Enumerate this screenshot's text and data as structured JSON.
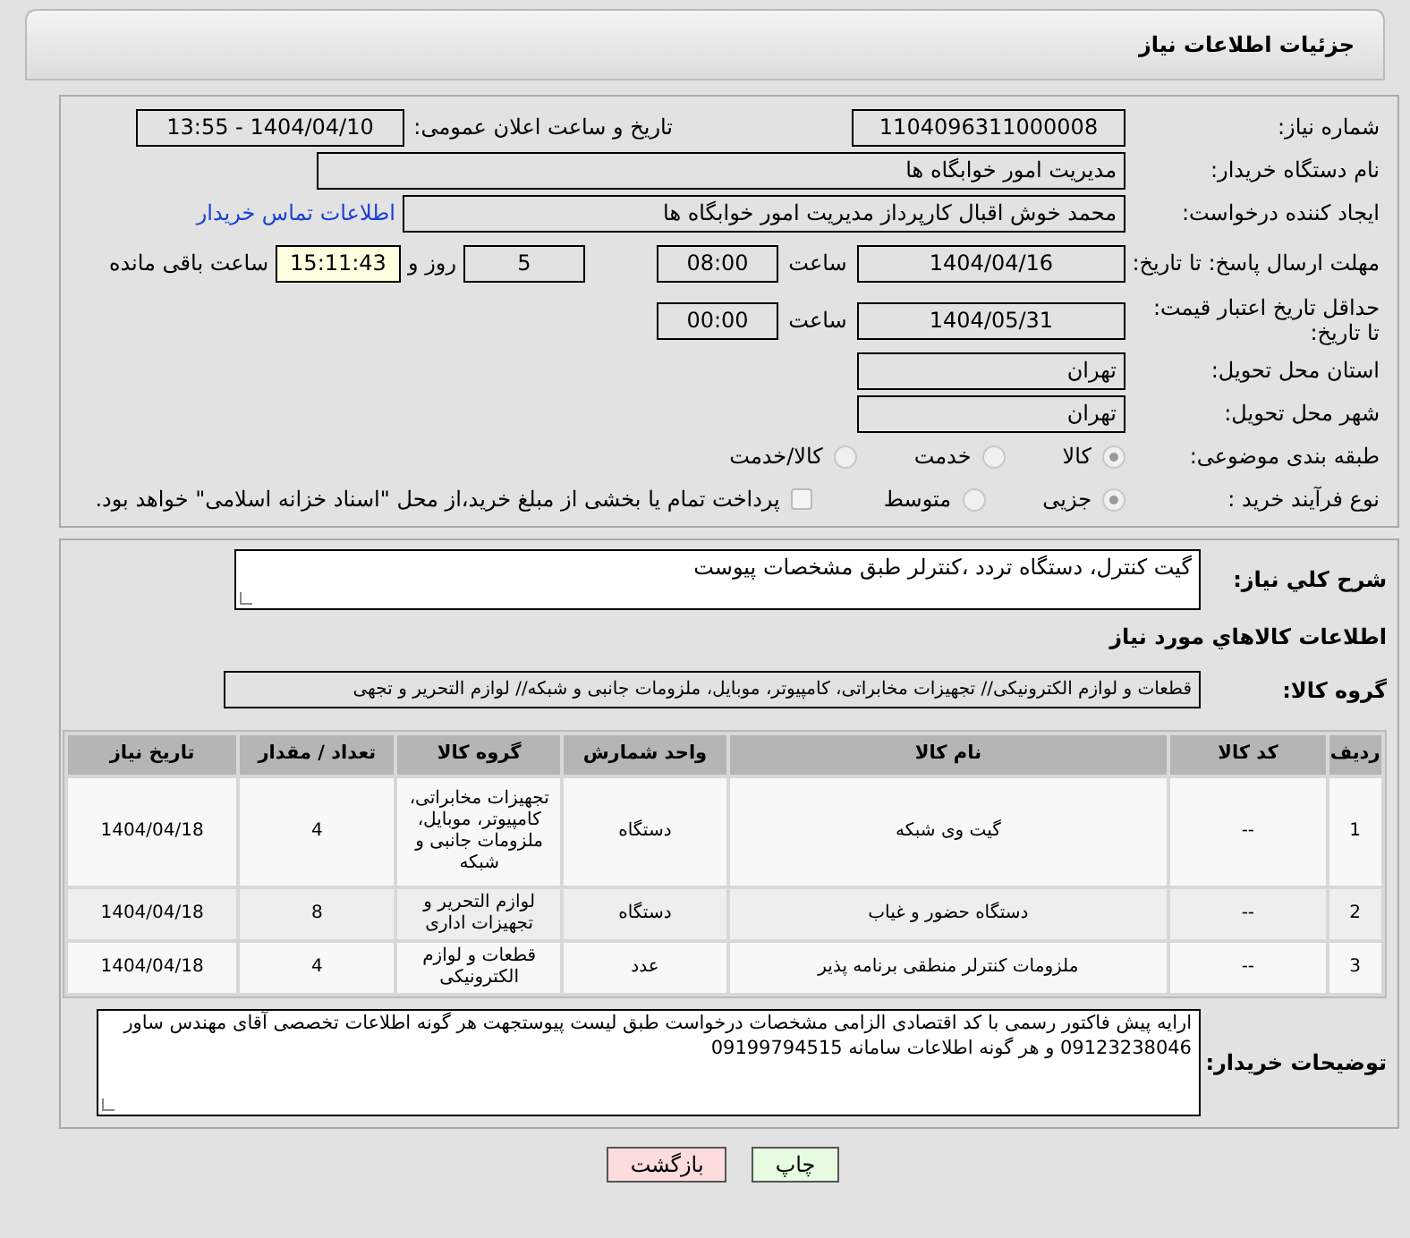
{
  "header": {
    "title": "جزئیات اطلاعات نیاز"
  },
  "need_number": {
    "label": "شماره نیاز:",
    "value": "1104096311000008"
  },
  "announce": {
    "label": "تاریخ و ساعت اعلان عمومی:",
    "value": "1404/04/10 - 13:55"
  },
  "buyer_org": {
    "label": "نام دستگاه خریدار:",
    "value": "مدیریت امور خوابگاه ها"
  },
  "requester": {
    "label": "ایجاد کننده درخواست:",
    "value": "محمد خوش اقبال کارپرداز مدیریت امور خوابگاه ها",
    "link": "اطلاعات تماس خریدار"
  },
  "deadline": {
    "label": "مهلت ارسال پاسخ: تا تاریخ:",
    "date": "1404/04/16",
    "time_label": "ساعت",
    "time": "08:00",
    "days": "5",
    "days_label": "روز و",
    "remaining": "15:11:43",
    "remaining_label": "ساعت باقی مانده"
  },
  "validity": {
    "label": "حداقل تاریخ اعتبار قیمت: تا تاریخ:",
    "date": "1404/05/31",
    "time_label": "ساعت",
    "time": "00:00"
  },
  "province": {
    "label": "استان محل تحویل:",
    "value": "تهران"
  },
  "city": {
    "label": "شهر محل تحویل:",
    "value": "تهران"
  },
  "category": {
    "label": "طبقه بندی موضوعی:",
    "options": [
      {
        "label": "كالا",
        "selected": true
      },
      {
        "label": "خدمت",
        "selected": false
      },
      {
        "label": "كالا/خدمت",
        "selected": false
      }
    ]
  },
  "process": {
    "label": "نوع فرآیند خرید :",
    "options": [
      {
        "label": "جزیی",
        "selected": true
      },
      {
        "label": "متوسط",
        "selected": false
      }
    ],
    "payment": {
      "label": "پرداخت تمام یا بخشی از مبلغ خرید،از محل \"اسناد خزانه اسلامی\" خواهد بود.",
      "checked": false
    }
  },
  "description": {
    "label": "شرح كلي نياز:",
    "value": "گیت کنترل، دستگاه تردد ،کنترلر طبق مشخصات پیوست"
  },
  "goods_title": "اطلاعات كالاهاي مورد نياز",
  "goods_group": {
    "label": "گروه کالا:",
    "value": "قطعات و لوازم الکترونیکی// تجهیزات مخابراتی، کامپیوتر، موبایل، ملزومات جانبی و شبکه// لوازم التحریر و تجهی"
  },
  "table": {
    "columns": [
      "ردیف",
      "کد کالا",
      "نام کالا",
      "واحد شمارش",
      "گروه کالا",
      "تعداد / مقدار",
      "تاریخ نیاز"
    ],
    "rows": [
      [
        "1",
        "--",
        "گیت وی شبکه",
        "دستگاه",
        "تجهیزات مخابراتی، کامپیوتر، موبایل، ملزومات جانبی و شبکه",
        "4",
        "1404/04/18"
      ],
      [
        "2",
        "--",
        "دستگاه حضور و غیاب",
        "دستگاه",
        "لوازم التحریر و تجهیزات اداری",
        "8",
        "1404/04/18"
      ],
      [
        "3",
        "--",
        "ملزومات کنترلر منطقی برنامه پذیر",
        "عدد",
        "قطعات و لوازم الکترونیکی",
        "4",
        "1404/04/18"
      ]
    ]
  },
  "buyer_notes": {
    "label": "توضیحات خریدار:",
    "value": "ارایه پیش فاکتور رسمی با کد اقتصادی الزامی  مشخصات درخواست طبق لیست پیوستجهت هر گونه اطلاعات تخصصی آقای مهندس ساور 09123238046 و هر گونه اطلاعات سامانه  09199794515"
  },
  "buttons": [
    {
      "label": "چاپ",
      "kind": "print"
    },
    {
      "label": "بازگشت",
      "kind": "back"
    }
  ]
}
